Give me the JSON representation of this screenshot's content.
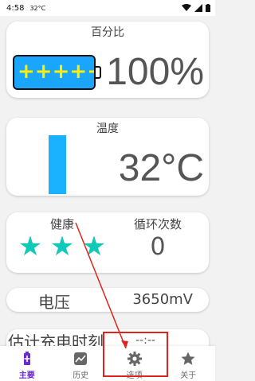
{
  "status_bar": {
    "time": "4:58",
    "temp_indicator": "32°C"
  },
  "percent_card": {
    "title": "百分比",
    "value": "100%",
    "level": 1.0,
    "plus_signs": [
      "+",
      "+",
      "+",
      "+",
      "+"
    ]
  },
  "temp_card": {
    "title": "温度",
    "value": "32°C"
  },
  "health_card": {
    "health_label": "健康",
    "health_stars": 3,
    "cycle_label": "循环次数",
    "cycle_value": "0"
  },
  "voltage_card": {
    "label": "电压",
    "value": "3650mV"
  },
  "estimate_card": {
    "label": "估计充电时刻",
    "value": "--:--"
  },
  "bottom_nav": {
    "items": [
      {
        "label": "主要",
        "icon": "battery-icon"
      },
      {
        "label": "历史",
        "icon": "chart-icon"
      },
      {
        "label": "选项",
        "icon": "gear-icon"
      },
      {
        "label": "关于",
        "icon": "star-icon"
      }
    ]
  },
  "colors": {
    "accent": "#6a2bd0",
    "battery_fill": "#1aa6ff",
    "plus": "#ffee00",
    "star": "#11c9b9",
    "annotation": "#e0241b"
  }
}
